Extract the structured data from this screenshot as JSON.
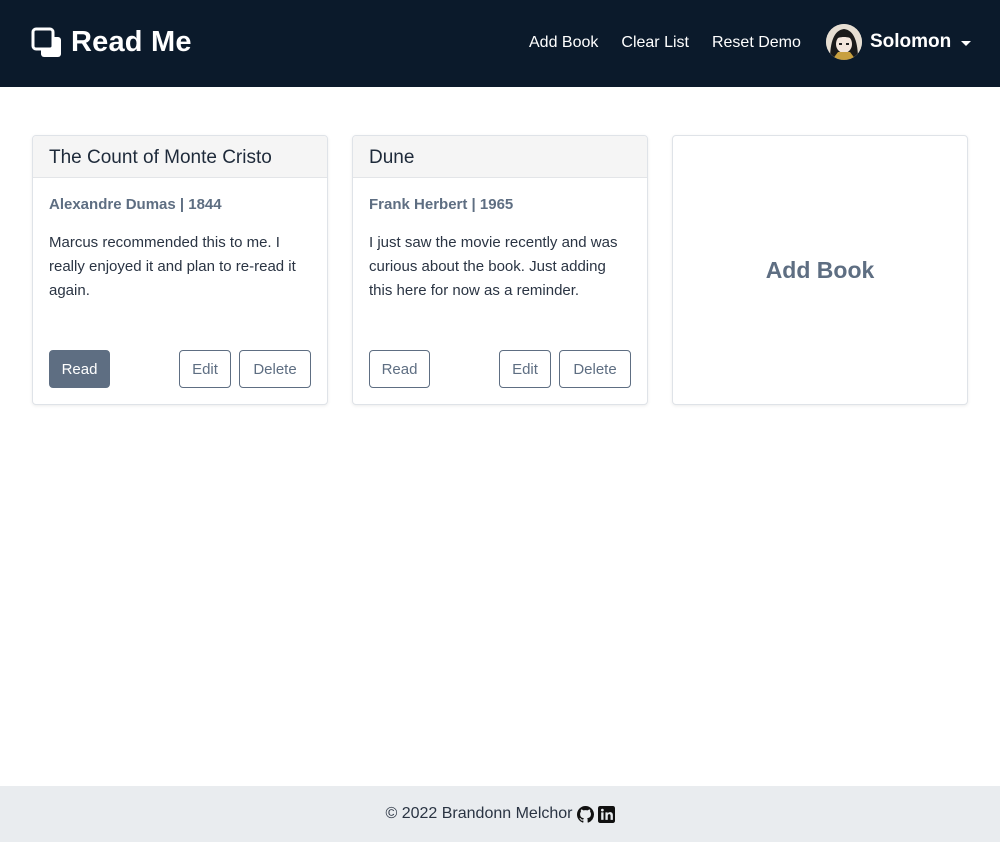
{
  "navbar": {
    "brand": "Read Me",
    "links": [
      "Add Book",
      "Clear List",
      "Reset Demo"
    ],
    "user": {
      "name": "Solomon"
    }
  },
  "books": [
    {
      "title": "The Count of Monte Cristo",
      "meta": "Alexandre Dumas | 1844",
      "note": "Marcus recommended this to me. I really enjoyed it and plan to re-read it again.",
      "read_label": "Read",
      "edit_label": "Edit",
      "delete_label": "Delete",
      "is_read": true
    },
    {
      "title": "Dune",
      "meta": "Frank Herbert | 1965",
      "note": "I just saw the movie recently and was curious about the book. Just adding this here for now as a reminder.",
      "read_label": "Read",
      "edit_label": "Edit",
      "delete_label": "Delete",
      "is_read": false
    }
  ],
  "add_card": {
    "label": "Add Book"
  },
  "footer": {
    "text": "© 2022 Brandonn Melchor"
  },
  "colors": {
    "navbar_bg": "#0b1a2b",
    "accent": "#5e6e82",
    "footer_bg": "#e9ecef"
  }
}
